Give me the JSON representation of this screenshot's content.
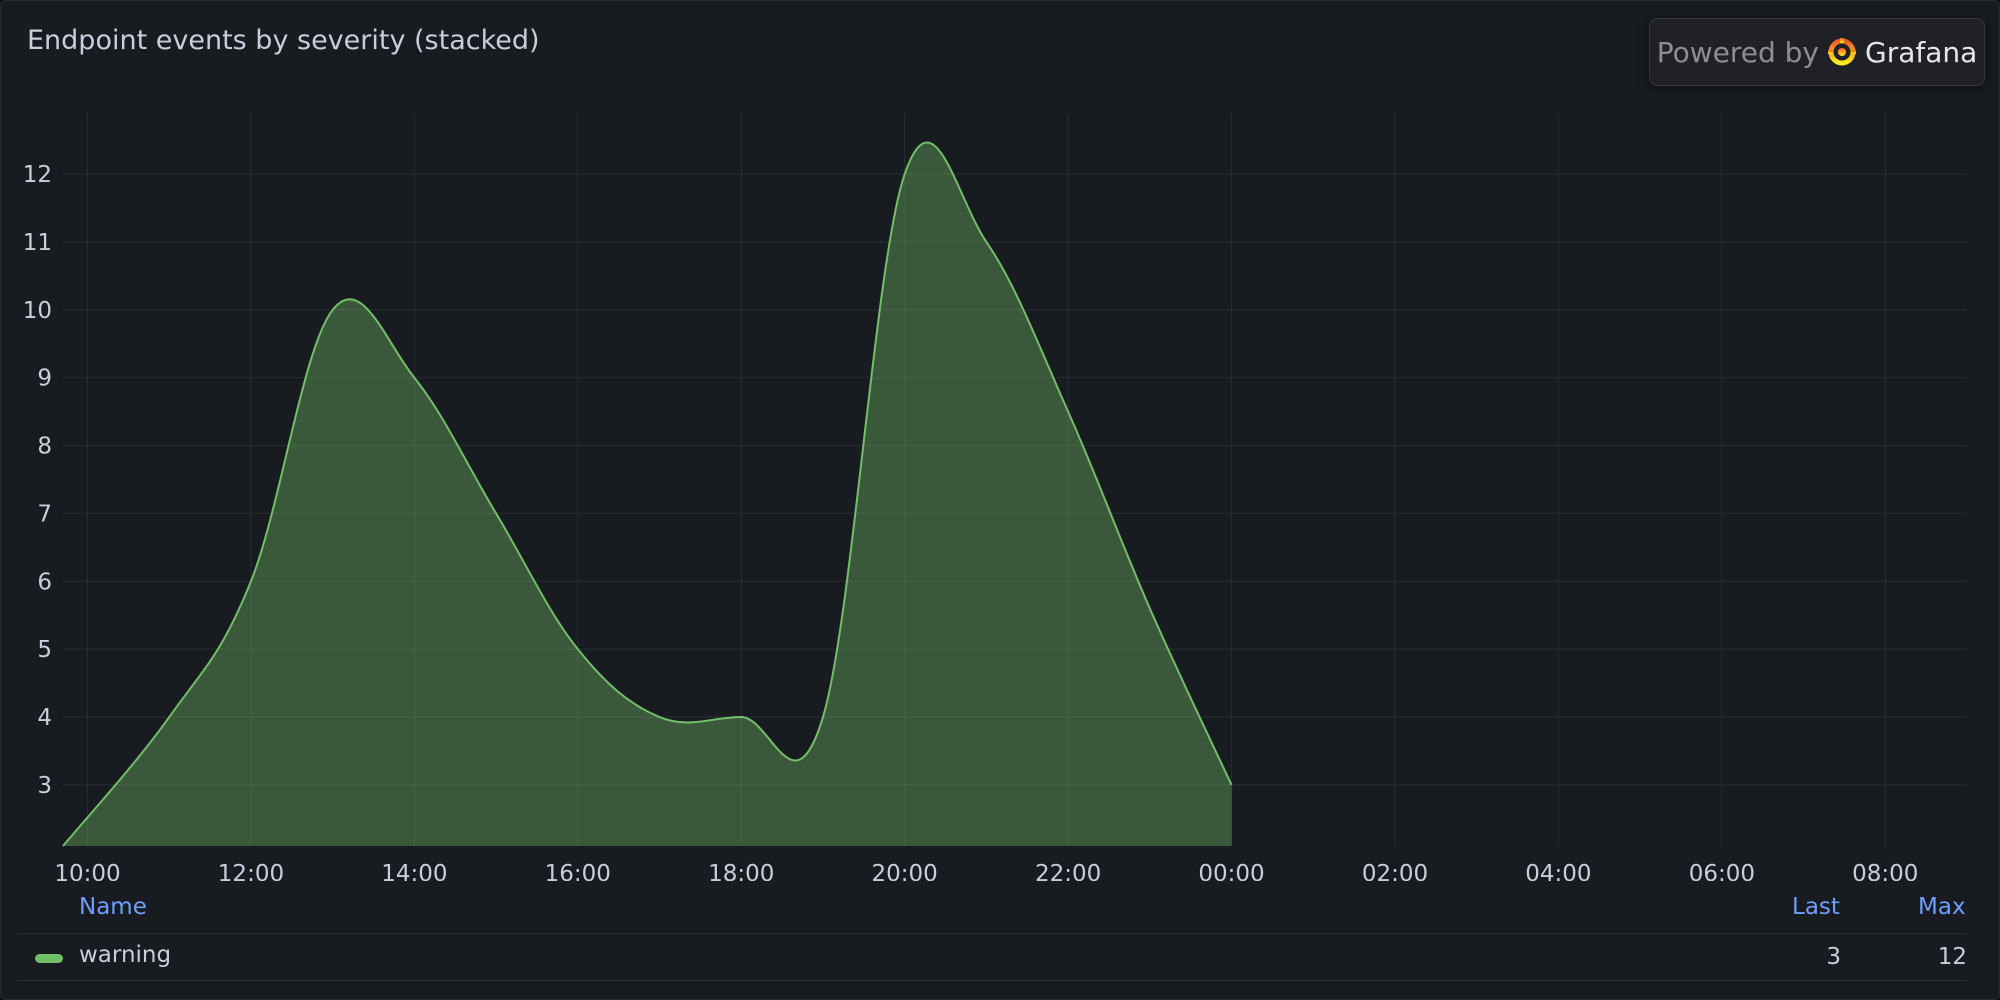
{
  "panel": {
    "title": "Endpoint events by severity (stacked)",
    "powered_by": "Powered by",
    "brand": "Grafana"
  },
  "colors": {
    "series": "#73bf69",
    "grid": "#2a2c32",
    "axis_text": "#ccccdc",
    "legend_header": "#6e9fff"
  },
  "legend": {
    "headers": {
      "name": "Name",
      "last": "Last",
      "max": "Max"
    },
    "rows": [
      {
        "name": "warning",
        "last": "3",
        "max": "12"
      }
    ]
  },
  "chart_data": {
    "type": "area",
    "title": "Endpoint events by severity (stacked)",
    "xlabel": "",
    "ylabel": "",
    "x_ticks": [
      "10:00",
      "12:00",
      "14:00",
      "16:00",
      "18:00",
      "20:00",
      "22:00",
      "00:00",
      "02:00",
      "04:00",
      "06:00",
      "08:00"
    ],
    "y_ticks": [
      3,
      4,
      5,
      6,
      7,
      8,
      9,
      10,
      11,
      12
    ],
    "xlim": [
      9.7,
      33.0
    ],
    "ylim": [
      2.1,
      12.9
    ],
    "grid": true,
    "legend_position": "bottom",
    "series": [
      {
        "name": "warning",
        "color": "#73bf69",
        "x": [
          9.7,
          11,
          12,
          13,
          14,
          15,
          16,
          17,
          18,
          19,
          20,
          21,
          22,
          23,
          24
        ],
        "values": [
          2.1,
          4,
          6,
          10,
          9,
          7,
          5,
          4,
          4,
          4,
          12,
          11,
          8.5,
          5.6,
          3
        ]
      }
    ]
  }
}
